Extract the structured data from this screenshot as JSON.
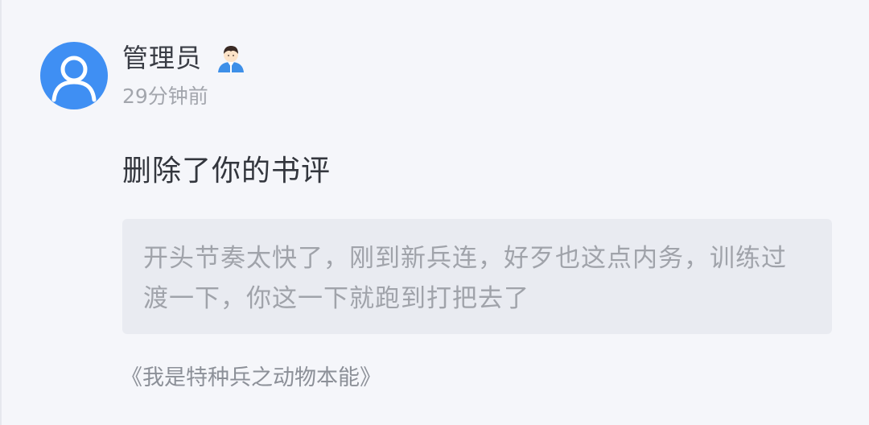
{
  "user": {
    "name": "管理员",
    "timestamp": "29分钟前"
  },
  "action": {
    "text": "删除了你的书评"
  },
  "review": {
    "text": "开头节奏太快了，刚到新兵连，好歹也这点内务，训练过渡一下，你这一下就跑到打把去了"
  },
  "book": {
    "title": "《我是特种兵之动物本能》"
  },
  "icons": {
    "avatar": "default-user-avatar-icon",
    "badge": "admin-badge-icon"
  },
  "colors": {
    "avatar_bg": "#3f8ff3",
    "quote_bg": "#e9ebf1",
    "page_bg": "#f5f6fa"
  }
}
